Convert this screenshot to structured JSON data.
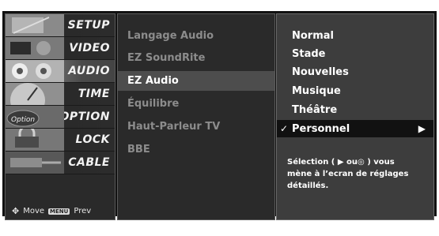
{
  "main_menu": [
    {
      "label": "SETUP",
      "thumb": "setup-thumbnail"
    },
    {
      "label": "VIDEO",
      "thumb": "video-thumbnail"
    },
    {
      "label": "AUDIO",
      "thumb": "audio-thumbnail",
      "active": true
    },
    {
      "label": "TIME",
      "thumb": "clock-thumbnail"
    },
    {
      "label": "OPTION",
      "thumb": "option-thumbnail"
    },
    {
      "label": "LOCK",
      "thumb": "lock-thumbnail"
    },
    {
      "label": "CABLE",
      "thumb": "cable-thumbnail"
    }
  ],
  "footer": {
    "move_label": "Move",
    "prev_key": "MENU",
    "prev_label": "Prev",
    "move_icon": "dpad-icon"
  },
  "audio_menu": [
    {
      "label": "Langage Audio"
    },
    {
      "label": "EZ SoundRite"
    },
    {
      "label": "EZ Audio",
      "selected": true
    },
    {
      "label": "Équilibre"
    },
    {
      "label": "Haut-Parleur TV"
    },
    {
      "label": "BBE"
    }
  ],
  "ez_audio_options": [
    {
      "label": "Normal"
    },
    {
      "label": "Stade"
    },
    {
      "label": "Nouvelles"
    },
    {
      "label": "Musique"
    },
    {
      "label": "Théâtre"
    },
    {
      "label": "Personnel",
      "selected": true,
      "check": "✓",
      "arrow": "▶"
    }
  ],
  "description": {
    "line1": "Sélection ( ▶ ou◎ ) vous",
    "line2": "mène à l’ecran de réglages",
    "line3": "détaillés."
  },
  "colors": {
    "accent": "#4d4d4d",
    "selected_bg": "#111111"
  }
}
